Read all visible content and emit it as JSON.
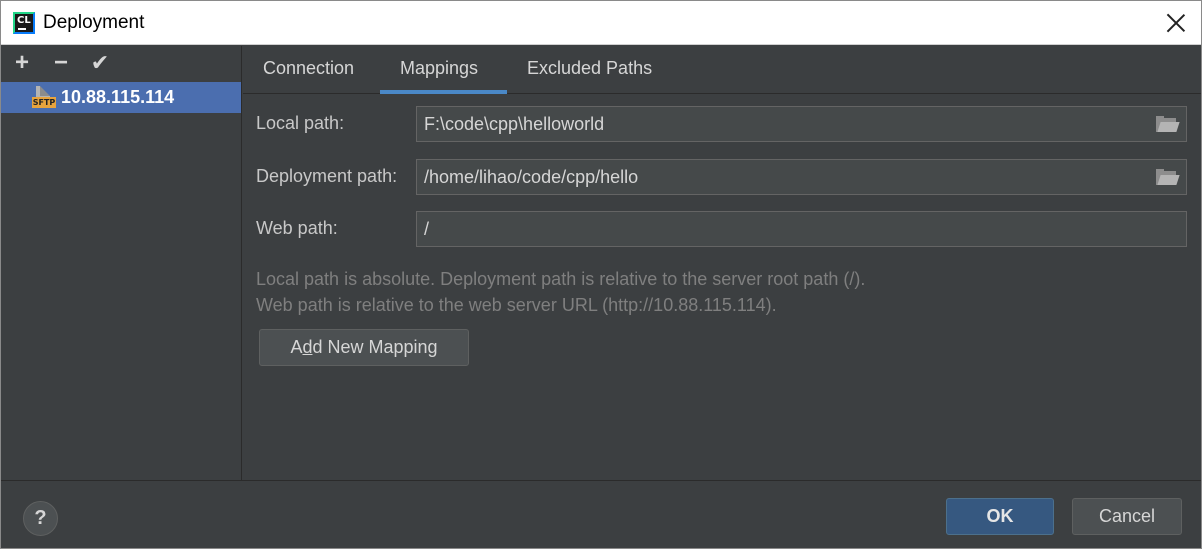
{
  "window": {
    "title": "Deployment",
    "app_icon": "clion-icon",
    "app_icon_text": "CL"
  },
  "toolbar": {
    "add_label": "+",
    "remove_label": "−",
    "apply_label": "✔"
  },
  "servers": [
    {
      "name": "10.88.115.114",
      "type": "SFTP",
      "selected": true
    }
  ],
  "tabs": [
    {
      "label": "Connection",
      "active": false
    },
    {
      "label": "Mappings",
      "active": true
    },
    {
      "label": "Excluded Paths",
      "active": false
    }
  ],
  "mappings": {
    "local_path_label": "Local path:",
    "local_path_value": "F:\\code\\cpp\\helloworld",
    "deployment_path_label": "Deployment path:",
    "deployment_path_value": "/home/lihao/code/cpp/hello",
    "web_path_label": "Web path:",
    "web_path_value": "/",
    "hint_line1": "Local path is absolute. Deployment path is relative to the server root path (/).",
    "hint_line2": "Web path is relative to the web server URL (http://10.88.115.114).",
    "add_mapping_pre": "A",
    "add_mapping_mnemonic": "d",
    "add_mapping_post": "d New Mapping"
  },
  "footer": {
    "help_label": "?",
    "ok_label": "OK",
    "cancel_label": "Cancel"
  },
  "colors": {
    "background": "#3c3f41",
    "selection": "#4b6eaf",
    "tab_underline": "#4a88c7",
    "ok_button": "#365880"
  }
}
